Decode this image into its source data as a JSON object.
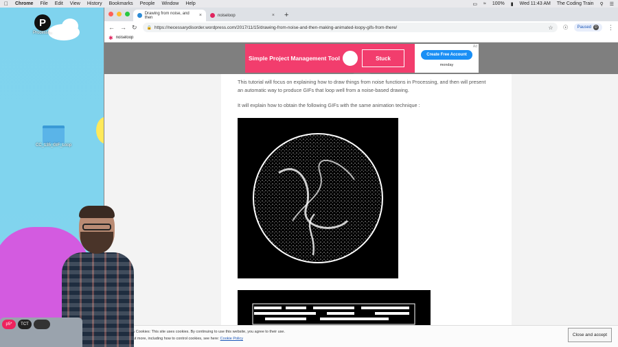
{
  "menubar": {
    "app": "Chrome",
    "menus": [
      "File",
      "Edit",
      "View",
      "History",
      "Bookmarks",
      "People",
      "Window",
      "Help"
    ],
    "battery": "100%",
    "clock": "Wed 11:43 AM",
    "user": "The Coding Train"
  },
  "desktop": {
    "icons": [
      {
        "label": "Processi...",
        "icon": "processing-logo-icon"
      },
      {
        "label": "CC_135_GIF_Loop",
        "icon": "folder-icon"
      }
    ],
    "laptop_stickers": [
      "p5*",
      "TCT"
    ]
  },
  "browser": {
    "tabs": [
      {
        "title": "Drawing from noise, and then",
        "active": true,
        "favicon_color": "#2d8bd6"
      },
      {
        "title": "noiseloop",
        "active": false,
        "favicon_color": "#e0245e"
      }
    ],
    "url": "https://necessarydisorder.wordpress.com/2017/11/15/drawing-from-noise-and-then-making-animated-loopy-gifs-from-there/",
    "profile_label": "Paused",
    "bookmark": "noiseloop"
  },
  "ad": {
    "title": "Simple Project Management Tool",
    "stuck_label": "Stuck",
    "cta": "Create Free Account",
    "brand": "monday",
    "flag": "Ad",
    "accent": "#f23d6d",
    "cta_color": "#1a8ff5"
  },
  "article": {
    "para1": "This tutorial will focus on explaining how to draw things from noise functions in Processing, and then will present an automatic way to produce GIFs that loop well from a noise-based drawing.",
    "para2": "It will explain how to obtain the following GIFs with the same animation technique :"
  },
  "cookie": {
    "text1": "Privacy & Cookies: This site uses cookies. By continuing to use this website, you agree to their use.",
    "text2": "To find out more, including how to control cookies, see here:",
    "link": "Cookie Policy",
    "button": "Close and accept"
  }
}
